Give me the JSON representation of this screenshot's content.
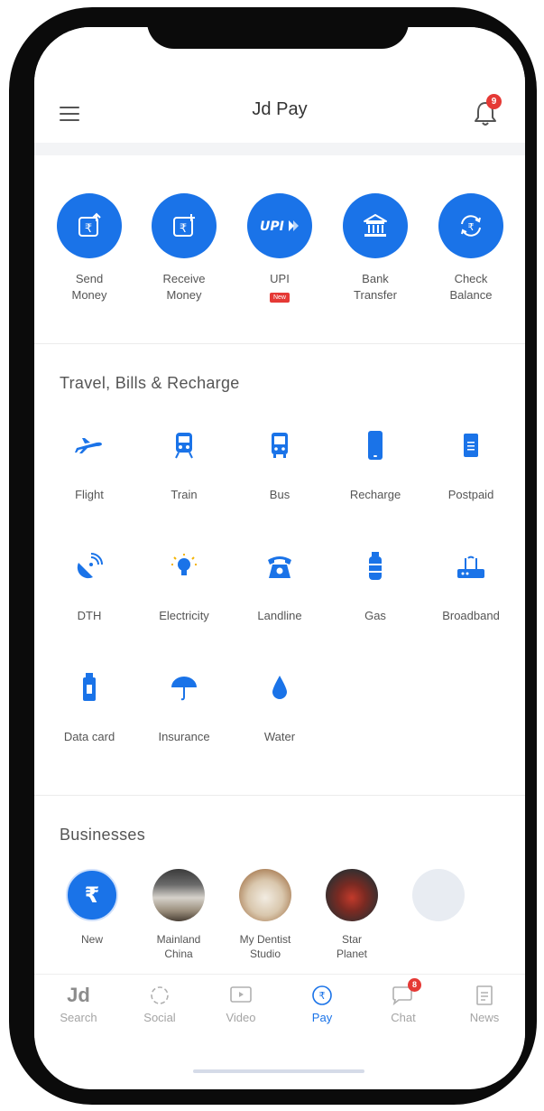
{
  "app": {
    "title": "Jd Pay",
    "notification_count": "9"
  },
  "colors": {
    "accent": "#1a73e8",
    "badge": "#e53935",
    "text": "#555555"
  },
  "money_actions": [
    {
      "line1": "Send",
      "line2": "Money",
      "icon": "send-money-icon"
    },
    {
      "line1": "Receive",
      "line2": "Money",
      "icon": "receive-money-icon"
    },
    {
      "line1": "UPI",
      "line2": "",
      "badge": "New",
      "icon": "upi-icon"
    },
    {
      "line1": "Bank",
      "line2": "Transfer",
      "icon": "bank-icon"
    },
    {
      "line1": "Check",
      "line2": "Balance",
      "icon": "check-balance-icon"
    }
  ],
  "travel": {
    "title": "Travel, Bills & Recharge",
    "items": [
      {
        "label": "Flight",
        "icon": "flight-icon"
      },
      {
        "label": "Train",
        "icon": "train-icon"
      },
      {
        "label": "Bus",
        "icon": "bus-icon"
      },
      {
        "label": "Recharge",
        "icon": "mobile-icon"
      },
      {
        "label": "Postpaid",
        "icon": "bill-icon"
      },
      {
        "label": "DTH",
        "icon": "dish-icon"
      },
      {
        "label": "Electricity",
        "icon": "bulb-icon"
      },
      {
        "label": "Landline",
        "icon": "phone-icon"
      },
      {
        "label": "Gas",
        "icon": "gas-cylinder-icon"
      },
      {
        "label": "Broadband",
        "icon": "router-icon"
      },
      {
        "label": "Data card",
        "icon": "datacard-icon"
      },
      {
        "label": "Insurance",
        "icon": "umbrella-icon"
      },
      {
        "label": "Water",
        "icon": "water-drop-icon"
      }
    ]
  },
  "businesses": {
    "title": "Businesses",
    "items": [
      {
        "line1": "New",
        "line2": ""
      },
      {
        "line1": "Mainland",
        "line2": "China"
      },
      {
        "line1": "My Dentist",
        "line2": "Studio"
      },
      {
        "line1": "Star",
        "line2": "Planet"
      }
    ]
  },
  "bottom_nav": {
    "search": "Search",
    "search_logo": "Jd",
    "social": "Social",
    "video": "Video",
    "pay": "Pay",
    "chat": "Chat",
    "news": "News",
    "chat_count": "8"
  }
}
